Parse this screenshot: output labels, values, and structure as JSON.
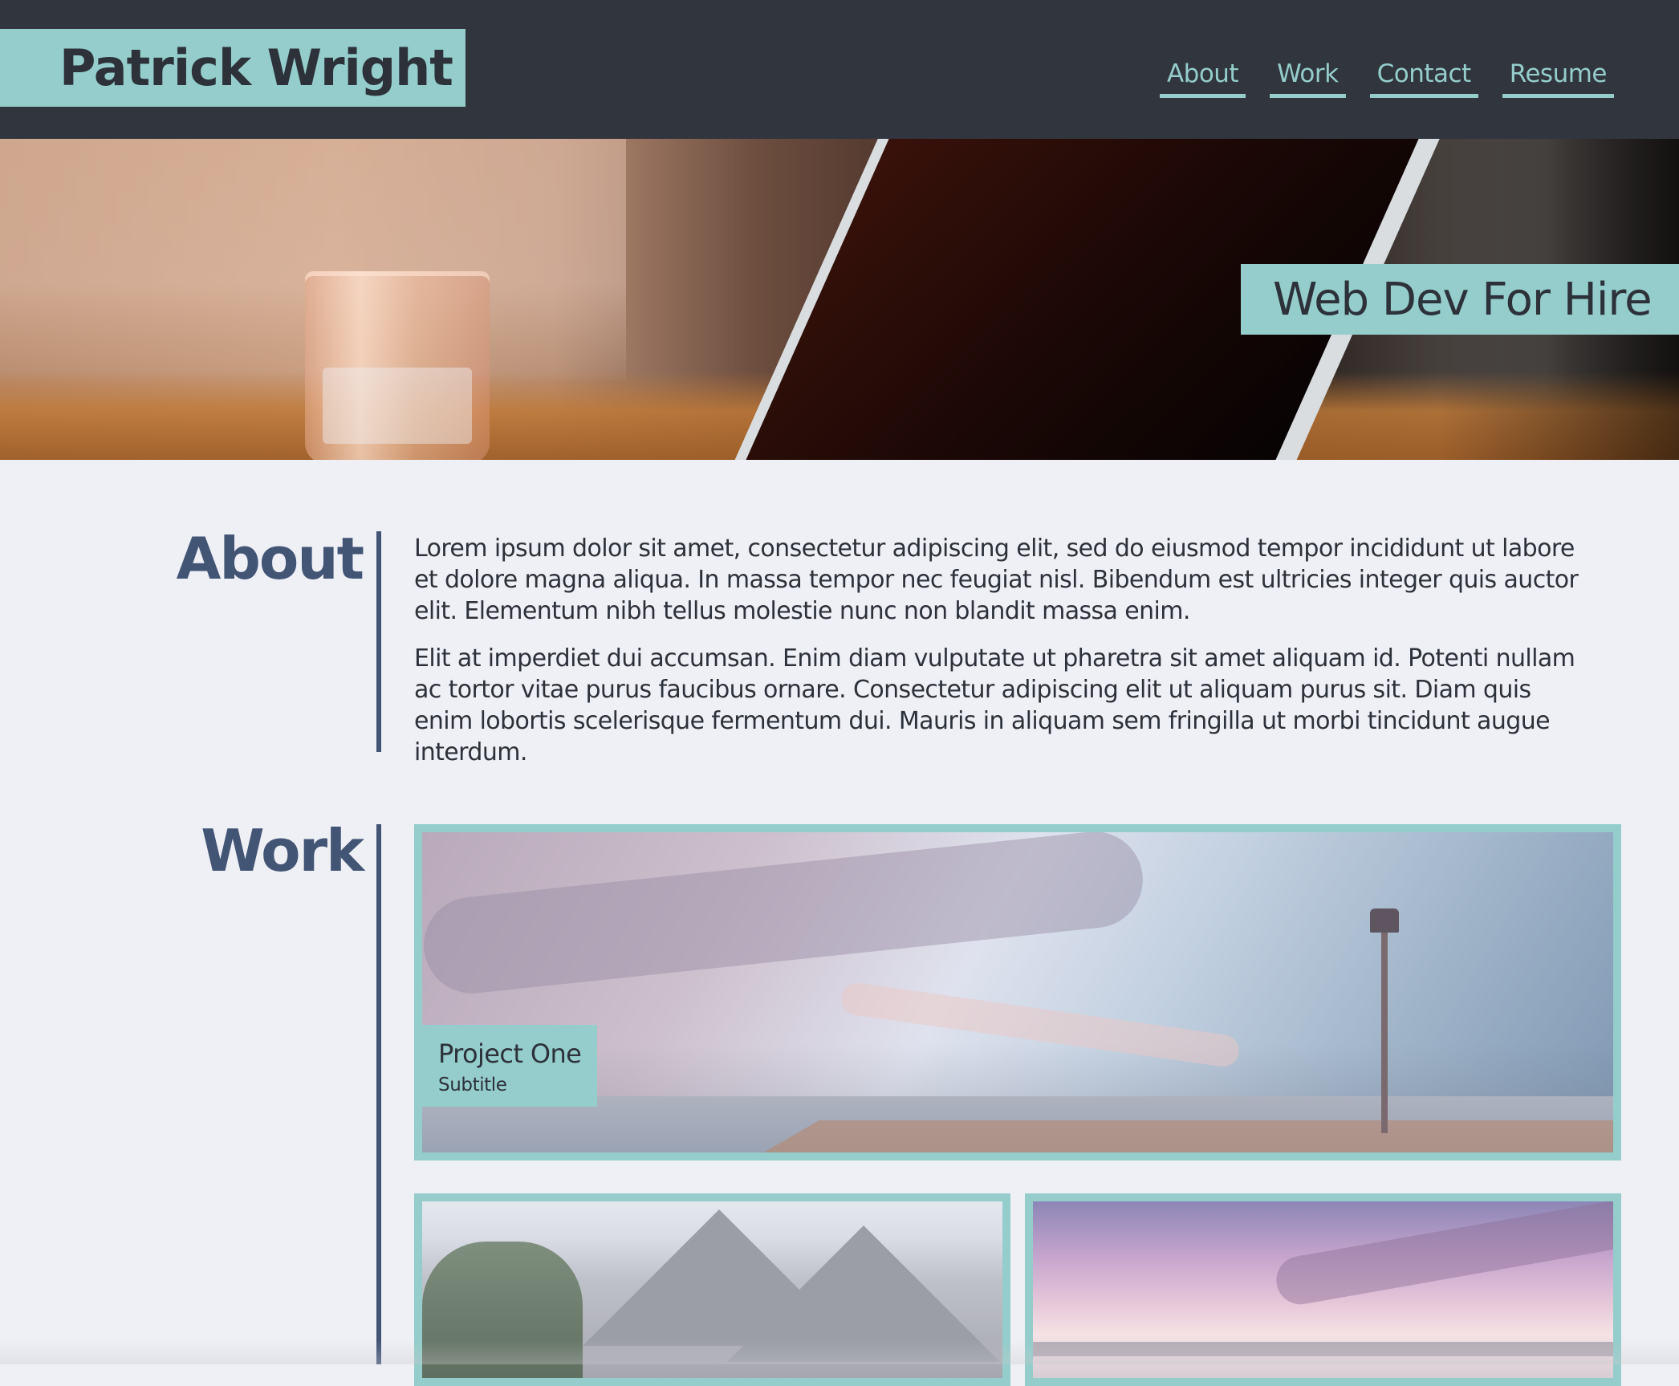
{
  "header": {
    "brand": "Patrick Wright",
    "nav": [
      "About",
      "Work",
      "Contact",
      "Resume"
    ]
  },
  "hero": {
    "tagline": "Web Dev For Hire"
  },
  "about": {
    "title": "About",
    "paragraphs": [
      "Lorem ipsum dolor sit amet, consectetur adipiscing elit, sed do eiusmod tempor incididunt ut labore et dolore magna aliqua. In massa tempor nec feugiat nisl. Bibendum est ultricies integer quis auctor elit. Elementum nibh tellus molestie nunc non blandit massa enim.",
      "Elit at imperdiet dui accumsan. Enim diam vulputate ut pharetra sit amet aliquam id. Potenti nullam ac tortor vitae purus faucibus ornare. Consectetur adipiscing elit ut aliquam purus sit. Diam quis enim lobortis scelerisque fermentum dui. Mauris in aliquam sem fringilla ut morbi tincidunt augue interdum."
    ]
  },
  "work": {
    "title": "Work",
    "projects": [
      {
        "title": "Project One",
        "subtitle": "Subtitle"
      }
    ]
  },
  "colors": {
    "topbar": "#31353e",
    "accent": "#94cdcc",
    "heading": "#425575",
    "background": "#efeff6",
    "text": "#2d313a"
  }
}
